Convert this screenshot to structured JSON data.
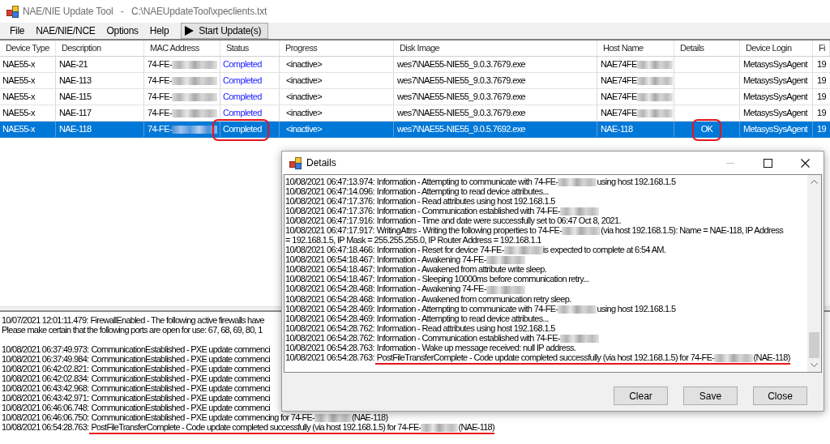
{
  "window": {
    "title": "NAE/NIE Update Tool   -   C:\\NAEUpdateTool\\xpeclients.txt"
  },
  "menu": {
    "items": [
      "File",
      "NAE/NIE/NCE",
      "Options",
      "Help"
    ],
    "start_button": "Start Update(s)"
  },
  "table": {
    "columns": [
      "Device Type",
      "Description",
      "MAC Address",
      "Status",
      "Progress",
      "Disk Image",
      "Host Name",
      "Details",
      "Device Login",
      "Fi"
    ],
    "rows": [
      {
        "selected": false,
        "device_type": "NAE55-x",
        "description": "NAE-21",
        "mac_address": {
          "text": "74-FE-",
          "blurred": true
        },
        "status": "Completed",
        "status_circled": false,
        "progress": "<inactive>",
        "disk_image": "wes7\\NAE55-NIE55_9.0.3.7679.exe",
        "host_name": {
          "text": "NAE74FE",
          "blurred": true
        },
        "details_circled": false,
        "device_login": "MetasysSysAgent",
        "column_10": "19"
      },
      {
        "selected": false,
        "device_type": "NAE55-x",
        "description": "NAE-113",
        "mac_address": {
          "text": "74-FE-",
          "blurred": true
        },
        "status": "Completed",
        "status_circled": false,
        "progress": "<inactive>",
        "disk_image": "wes7\\NAE55-NIE55_9.0.3.7679.exe",
        "host_name": {
          "text": "NAE74FE",
          "blurred": true
        },
        "details_circled": false,
        "device_login": "MetasysSysAgent",
        "column_10": "19"
      },
      {
        "selected": false,
        "device_type": "NAE55-x",
        "description": "NAE-115",
        "mac_address": {
          "text": "74-FE-",
          "blurred": true
        },
        "status": "Completed",
        "status_circled": false,
        "progress": "<inactive>",
        "disk_image": "wes7\\NAE55-NIE55_9.0.3.7679.exe",
        "host_name": {
          "text": "NAE74FE",
          "blurred": true
        },
        "details_circled": false,
        "device_login": "MetasysSysAgent",
        "column_10": "19"
      },
      {
        "selected": false,
        "device_type": "NAE55-x",
        "description": "NAE-117",
        "mac_address": {
          "text": "74-FE-",
          "blurred": true
        },
        "status": "Completed",
        "status_circled": false,
        "progress": "<inactive>",
        "disk_image": "wes7\\NAE55-NIE55_9.0.3.7679.exe",
        "host_name": {
          "text": "NAE74FE",
          "blurred": true
        },
        "details_circled": false,
        "device_login": "MetasysSysAgent",
        "column_10": "19"
      },
      {
        "selected": true,
        "device_type": "NAE55-x",
        "description": "NAE-118",
        "mac_address": {
          "text": "74-FE-",
          "blurred": true
        },
        "status": "Completed",
        "status_circled": true,
        "progress": "<inactive>",
        "disk_image": "wes7\\NAE55-NIE55_9.0.5.7692.exe",
        "host_name": {
          "text": "NAE-118",
          "blurred": false
        },
        "details": "OK",
        "details_circled": true,
        "device_login": "MetasysSysAgent",
        "column_10": "19"
      }
    ]
  },
  "log_pane": {
    "groups": [
      {
        "lines": [
          {
            "time": "10/07/2021 12:01:11.479:",
            "message": "FirewallEnabled - The following active firewalls have",
            "blurred": false,
            "underlined": false
          },
          {
            "message": "Please make certain that the following ports are open for use: 67, 68, 69, 80, 1",
            "blurred": false,
            "underlined": false
          }
        ]
      },
      {
        "lines": [
          {
            "time": "10/08/2021 06:37:49.973:",
            "message": "CommunicationEstablished - PXE update commenci",
            "blurred": false,
            "underlined": false
          },
          {
            "time": "10/08/2021 06:37:49.984:",
            "message": "CommunicationEstablished - PXE update commenci",
            "blurred": false,
            "underlined": false
          },
          {
            "time": "10/08/2021 06:42:02.821:",
            "message": "CommunicationEstablished - PXE update commenci",
            "blurred": false,
            "underlined": false
          },
          {
            "time": "10/08/2021 06:42:02.834:",
            "message": "CommunicationEstablished - PXE update commenci",
            "blurred": false,
            "underlined": false
          },
          {
            "time": "10/08/2021 06:43:42.968:",
            "message": "CommunicationEstablished - PXE update commenci",
            "blurred": false,
            "underlined": false
          },
          {
            "time": "10/08/2021 06:43:42.971:",
            "message": "CommunicationEstablished - PXE update commenci",
            "blurred": false,
            "underlined": false
          },
          {
            "time": "10/08/2021 06:46:06.748:",
            "message": "CommunicationEstablished - PXE update commenci",
            "blurred": false,
            "underlined": false
          },
          {
            "time": "10/08/2021 06:46:06.750:",
            "message": "CommunicationEstablished - PXE update commencing for 74-FE-",
            "blurred": true,
            "after": "(NAE-118)",
            "underlined": false
          },
          {
            "time": "10/08/2021 06:54:28.763:",
            "message": "PostFileTransferComplete - Code update completed successfully (via host 192.168.1.5) for 74-FE-",
            "blurred": true,
            "after": "(NAE-118)",
            "underlined": true
          }
        ]
      }
    ]
  },
  "details_dialog": {
    "title": "Details",
    "window_controls": [
      {
        "kind": "minimize",
        "disabled": true
      },
      {
        "kind": "maximize",
        "disabled": false
      },
      {
        "kind": "close",
        "disabled": false
      }
    ],
    "lines": [
      {
        "time": "10/08/2021 06:47:13.974:",
        "message": "Information - Attempting to communicate with 74-FE-",
        "blurred": true,
        "after": "using host 192.168.1.5",
        "underlined": false
      },
      {
        "time": "10/08/2021 06:47:14.096:",
        "message": "Information - Attempting to read device attributes...",
        "blurred": false,
        "underlined": false
      },
      {
        "time": "10/08/2021 06:47:17.376:",
        "message": "Information - Read attributes using host 192.168.1.5",
        "blurred": false,
        "underlined": false
      },
      {
        "time": "10/08/2021 06:47:17.376:",
        "message": "Information - Communication established with 74-FE-",
        "blurred": true,
        "underlined": false
      },
      {
        "time": "10/08/2021 06:47:17.916:",
        "message": "Information - Time and date were successfully set to 06:47 Oct 8, 2021.",
        "blurred": false,
        "underlined": false
      },
      {
        "time": "10/08/2021 06:47:17.917:",
        "message": "WritingAttrs - Writing the following properties to 74-FE-",
        "blurred": true,
        "after": "(via host 192.168.1.5): Name = NAE-118, IP Address",
        "continuation": "= 192.168.1.5, IP Mask = 255.255.255.0, IP Router Address = 192.168.1.1",
        "underlined": false
      },
      {
        "time": "10/08/2021 06:47:18.466:",
        "message": "Information - Reset for device 74-FE-",
        "blurred": true,
        "after": "is expected to complete at 6:54 AM.",
        "underlined": false
      },
      {
        "time": "10/08/2021 06:54:18.467:",
        "message": "Information - Awakening 74-FE-",
        "blurred": true,
        "underlined": false
      },
      {
        "time": "10/08/2021 06:54:18.467:",
        "message": "Information - Awakened from attribute write sleep.",
        "blurred": false,
        "underlined": false
      },
      {
        "time": "10/08/2021 06:54:18.467:",
        "message": "Information - Sleeping 10000ms before communication retry...",
        "blurred": false,
        "underlined": false
      },
      {
        "time": "10/08/2021 06:54:28.468:",
        "message": "Information - Awakening 74-FE-",
        "blurred": true,
        "underlined": false
      },
      {
        "time": "10/08/2021 06:54:28.468:",
        "message": "Information - Awakened from communication retry sleep.",
        "blurred": false,
        "underlined": false
      },
      {
        "time": "10/08/2021 06:54:28.469:",
        "message": "Information - Attempting to communicate with 74-FE-",
        "blurred": true,
        "after": "using host 192.168.1.5",
        "underlined": false
      },
      {
        "time": "10/08/2021 06:54:28.469:",
        "message": "Information - Attempting to read device attributes...",
        "blurred": false,
        "underlined": false
      },
      {
        "time": "10/08/2021 06:54:28.762:",
        "message": "Information - Read attributes using host 192.168.1.5",
        "blurred": false,
        "underlined": false
      },
      {
        "time": "10/08/2021 06:54:28.762:",
        "message": "Information - Communication established with 74-FE-",
        "blurred": true,
        "underlined": false
      },
      {
        "time": "10/08/2021 06:54:28.763:",
        "message": "Information - Wake up message received: null IP address.",
        "blurred": false,
        "underlined": false
      },
      {
        "time": "10/08/2021 06:54:28.763:",
        "message": "PostFileTransferComplete - Code update completed successfully (via host 192.168.1.5) for 74-FE-",
        "blurred": true,
        "after": "(NAE-118)",
        "underlined": true
      }
    ],
    "buttons": [
      "Clear",
      "Save",
      "Close"
    ]
  }
}
